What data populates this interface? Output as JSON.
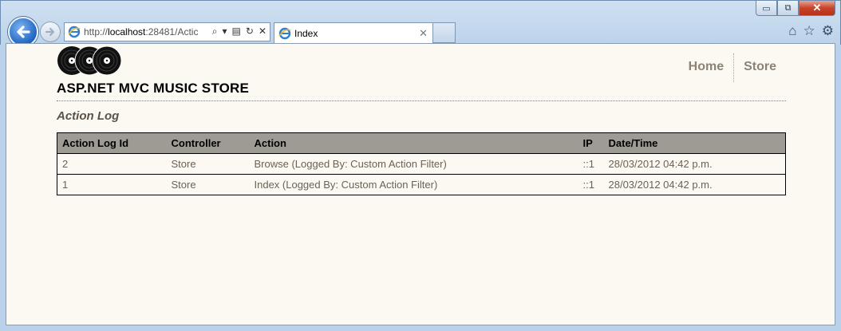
{
  "browser": {
    "address_url_prefix": "http://",
    "address_host": "localhost",
    "address_rest": ":28481/Actic",
    "tab_title": "Index",
    "window_controls": {
      "minimize": "▭",
      "restore": "⧉",
      "close": "✕"
    },
    "address_actions": {
      "search": "⌕",
      "dropdown": "▾",
      "compat": "▤",
      "refresh": "↻",
      "stop": "✕"
    },
    "tab_close": "✕",
    "command_icons": {
      "home": "⌂",
      "favorites": "☆",
      "tools": "⚙"
    }
  },
  "site": {
    "title": "ASP.NET MVC MUSIC STORE",
    "nav": [
      {
        "label": "Home"
      },
      {
        "label": "Store"
      }
    ]
  },
  "page": {
    "section_title": "Action Log",
    "table": {
      "columns": [
        "Action Log Id",
        "Controller",
        "Action",
        "IP",
        "Date/Time"
      ],
      "rows": [
        [
          "2",
          "Store",
          "Browse (Logged By: Custom Action Filter)",
          "::1",
          "28/03/2012 04:42 p.m."
        ],
        [
          "1",
          "Store",
          "Index (Logged By: Custom Action Filter)",
          "::1",
          "28/03/2012 04:42 p.m."
        ]
      ]
    }
  },
  "colors": {
    "page_background": "#fcf9f2",
    "table_header": "#9e9b95",
    "nav_text": "#8b8476",
    "cell_text": "#6b6254"
  }
}
